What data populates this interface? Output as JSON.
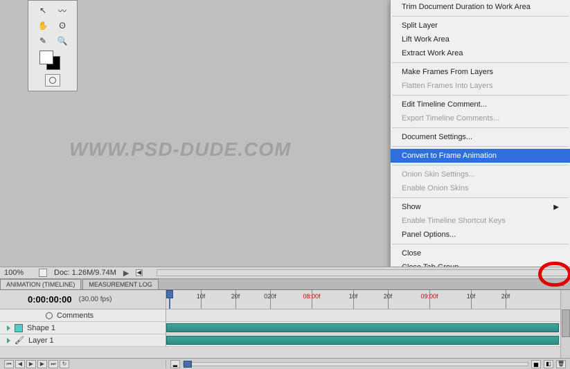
{
  "toolbox": {
    "tools": [
      [
        "arrow-icon",
        "lasso-icon"
      ],
      [
        "hand-icon",
        "lasso2-icon"
      ],
      [
        "eyedropper-icon",
        "zoom-icon"
      ]
    ]
  },
  "watermark": "WWW.PSD-DUDE.COM",
  "menu": {
    "items": [
      {
        "label": "Trim Document Duration to Work Area",
        "enabled": true,
        "sep_after": true
      },
      {
        "label": "Split Layer",
        "enabled": true
      },
      {
        "label": "Lift Work Area",
        "enabled": true
      },
      {
        "label": "Extract Work Area",
        "enabled": true,
        "sep_after": true
      },
      {
        "label": "Make Frames From Layers",
        "enabled": true
      },
      {
        "label": "Flatten Frames Into Layers",
        "enabled": false,
        "sep_after": true
      },
      {
        "label": "Edit Timeline Comment...",
        "enabled": true
      },
      {
        "label": "Export Timeline Comments...",
        "enabled": false,
        "sep_after": true
      },
      {
        "label": "Document Settings...",
        "enabled": true,
        "sep_after": true
      },
      {
        "label": "Convert to Frame Animation",
        "enabled": true,
        "highlight": true,
        "sep_after": true
      },
      {
        "label": "Onion Skin Settings...",
        "enabled": false
      },
      {
        "label": "Enable Onion Skins",
        "enabled": false,
        "sep_after": true
      },
      {
        "label": "Show",
        "enabled": true,
        "submenu": true
      },
      {
        "label": "Enable Timeline Shortcut Keys",
        "enabled": false
      },
      {
        "label": "Panel Options...",
        "enabled": true,
        "sep_after": true
      },
      {
        "label": "Close",
        "enabled": true
      },
      {
        "label": "Close Tab Group",
        "enabled": true
      }
    ]
  },
  "status": {
    "zoom": "100%",
    "doc": "Doc: 1.26M/9.74M"
  },
  "tabs": {
    "active": "ANIMATION (TIMELINE)",
    "other": "MEASUREMENT LOG"
  },
  "timeline": {
    "time": "0:00:00:00",
    "fps": "(30.00 fps)",
    "ruler": [
      {
        "label": "10f",
        "pos": 50
      },
      {
        "label": "20f",
        "pos": 100
      },
      {
        "label": "020f",
        "pos": 150
      },
      {
        "label": "08:00f",
        "pos": 210,
        "red": true
      },
      {
        "label": "10f",
        "pos": 270
      },
      {
        "label": "20f",
        "pos": 320
      },
      {
        "label": "09:00f",
        "pos": 380,
        "red": true
      },
      {
        "label": "10f",
        "pos": 440
      },
      {
        "label": "20f",
        "pos": 490
      }
    ],
    "rows": [
      {
        "name": "Comments",
        "icon": "clock"
      },
      {
        "name": "Shape 1",
        "icon": "shape",
        "clip": true
      },
      {
        "name": "Layer 1",
        "icon": "brush",
        "clip": true
      }
    ]
  }
}
